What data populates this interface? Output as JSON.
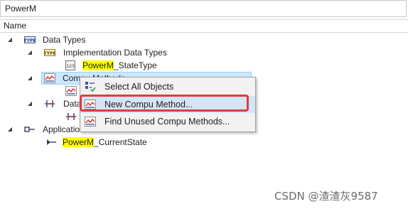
{
  "search": {
    "value": "PowerM"
  },
  "header": {
    "column_name": "Name"
  },
  "tree": {
    "data_types": "Data Types",
    "impl_data_types": "Implementation Data Types",
    "state_type_prefix": "PowerM",
    "state_type_suffix": "_StateType",
    "compu_methods": "Compu Methods",
    "data_partial": "Data",
    "app_port_interfaces": "Application Port Interfaces",
    "current_state_prefix": "PowerM",
    "current_state_suffix": "_CurrentState"
  },
  "context_menu": {
    "items": [
      {
        "label": "Select All Objects",
        "icon": "select-all-icon"
      },
      {
        "label": "New Compu Method...",
        "icon": "compu-method-icon"
      },
      {
        "label": "Find Unused Compu Methods...",
        "icon": "compu-method-search-icon"
      }
    ]
  },
  "watermark": "CSDN @渣渣灰9587",
  "colors": {
    "highlight": "#ffff00",
    "selection": "#cce8ff",
    "annotation": "#e23b3b",
    "menu_hover": "#d3e6f7"
  }
}
